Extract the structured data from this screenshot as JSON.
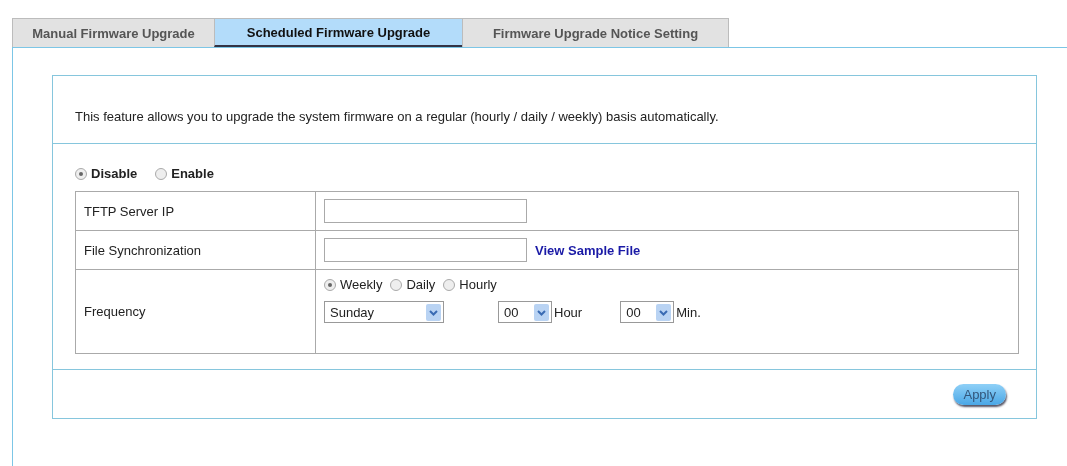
{
  "tabs": [
    {
      "label": "Manual Firmware Upgrade",
      "selected": false
    },
    {
      "label": "Scheduled Firmware Upgrade",
      "selected": true
    },
    {
      "label": "Firmware Upgrade Notice Setting",
      "selected": false
    }
  ],
  "description": "This feature allows you to upgrade the system firmware on a regular (hourly / daily / weekly) basis automatically.",
  "mode": [
    {
      "label": "Disable",
      "selected": true
    },
    {
      "label": "Enable",
      "selected": false
    }
  ],
  "rows": [
    {
      "kind": "input",
      "label": "TFTP Server IP"
    },
    {
      "kind": "input",
      "label": "File Synchronization",
      "link": "View Sample File"
    },
    {
      "kind": "frequency",
      "label": "Frequency",
      "options": [
        {
          "label": "Weekly",
          "selected": true
        },
        {
          "label": "Daily",
          "selected": false
        },
        {
          "label": "Hourly",
          "selected": false
        }
      ],
      "day": "Sunday",
      "hour": "00",
      "hour_unit": "Hour",
      "minute": "00",
      "minute_unit": "Min."
    }
  ],
  "apply": "Apply"
}
